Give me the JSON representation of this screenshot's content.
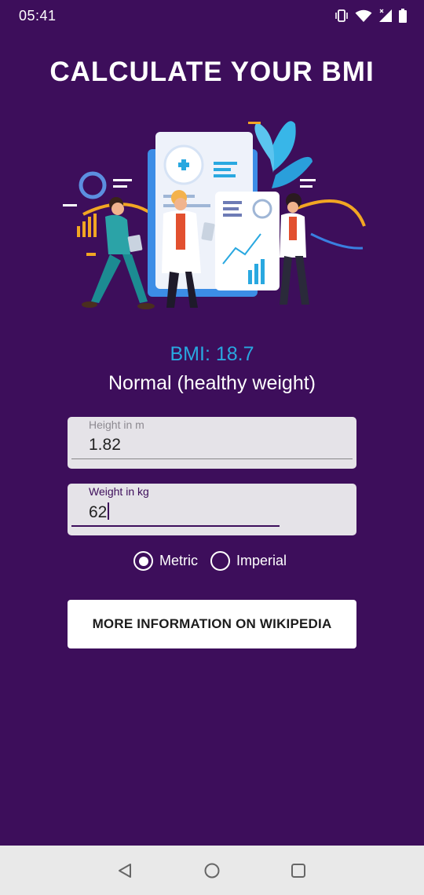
{
  "status": {
    "time": "05:41",
    "icons": [
      "vibrate-icon",
      "wifi-icon",
      "signal-icon",
      "battery-icon"
    ]
  },
  "title": "CALCULATE YOUR BMI",
  "illustration": "doctors-with-medical-chart-illustration",
  "result": {
    "bmi": "BMI: 18.7",
    "category": "Normal (healthy weight)"
  },
  "fields": {
    "height": {
      "label": "Height in m",
      "value": "1.82"
    },
    "weight": {
      "label": "Weight in kg",
      "value": "62"
    }
  },
  "units": {
    "options": [
      "Metric",
      "Imperial"
    ],
    "selected": "Metric"
  },
  "button": {
    "label": "MORE INFORMATION ON WIKIPEDIA"
  },
  "nav": [
    "back-icon",
    "home-icon",
    "recents-icon"
  ],
  "colors": {
    "background": "#3d0e5b",
    "accent": "#29a8e0",
    "field_bg": "#e5e3e8",
    "nav_bg": "#e9e9e9"
  }
}
